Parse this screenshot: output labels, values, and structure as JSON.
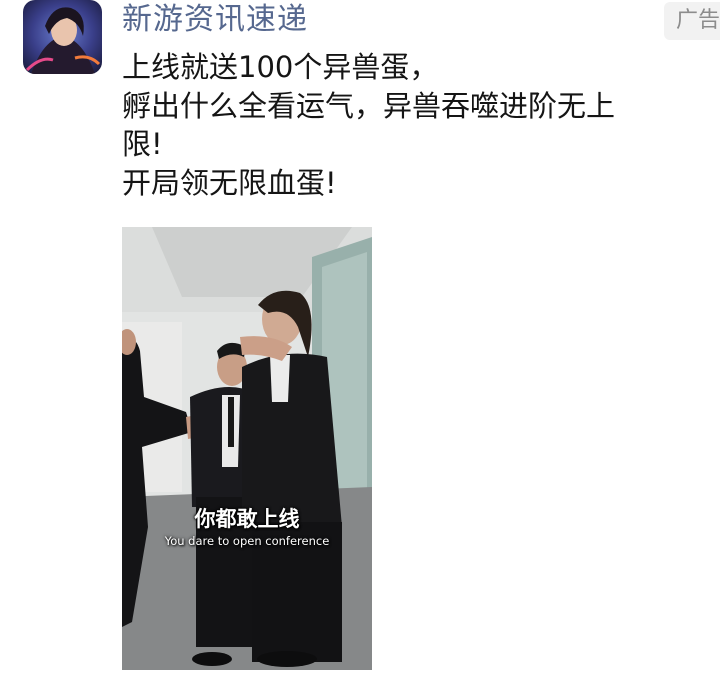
{
  "post": {
    "account_name": "新游资讯速递",
    "ad_label": "广告",
    "text_lines": [
      "上线就送100个异兽蛋，",
      "孵出什么全看运气，异兽吞噬进阶无上",
      "限!",
      "开局领无限血蛋!"
    ]
  },
  "video": {
    "subtitle_zh": "你都敢上线",
    "subtitle_en": "You dare to open conference"
  },
  "colors": {
    "account_name": "#56688f",
    "ad_badge_bg": "#f2f2f2",
    "body_text": "#151515"
  }
}
